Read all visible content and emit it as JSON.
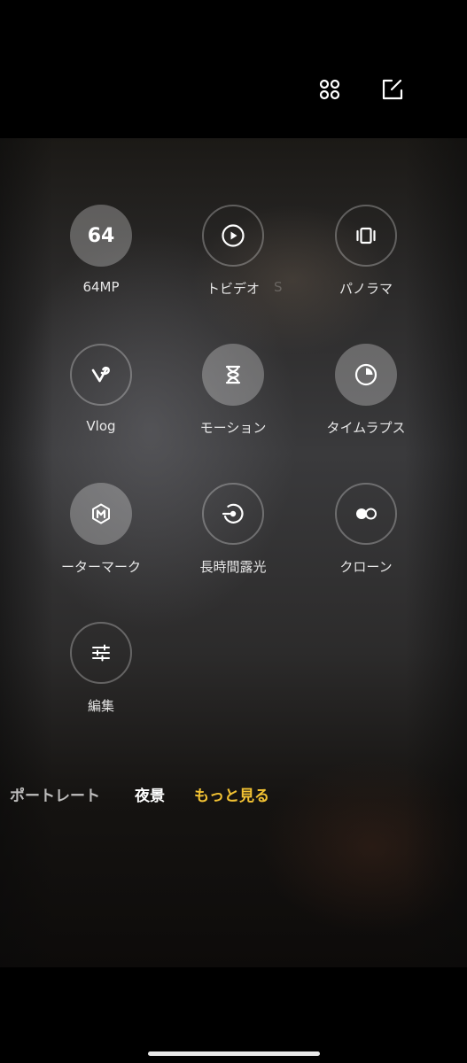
{
  "top_controls": {
    "grid_icon": "four-circles-grid-icon",
    "edit_icon": "edit-square-pencil-icon"
  },
  "modes": [
    {
      "id": "64mp",
      "label": "64MP",
      "icon_text": "64",
      "filled": true
    },
    {
      "id": "short-video",
      "label": "トビデオ",
      "icon": "play-circle-icon",
      "filled": false,
      "ghost_label": "S"
    },
    {
      "id": "panorama",
      "label": "パノラマ",
      "icon": "panorama-icon",
      "filled": false
    },
    {
      "id": "vlog",
      "label": "Vlog",
      "icon": "vlog-v-icon",
      "filled": false
    },
    {
      "id": "slow-motion",
      "label": "モーション",
      "icon": "hourglass-icon",
      "filled": true
    },
    {
      "id": "timelapse",
      "label": "タイムラプス",
      "icon": "pie-clock-icon",
      "filled": true
    },
    {
      "id": "watermark",
      "label": "ーターマーク",
      "icon": "hexagon-m-icon",
      "filled": true
    },
    {
      "id": "long-exposure",
      "label": "長時間露光",
      "icon": "long-exposure-icon",
      "filled": false
    },
    {
      "id": "clone",
      "label": "クローン",
      "icon": "clone-dots-icon",
      "filled": false
    },
    {
      "id": "edit",
      "label": "編集",
      "icon": "sliders-icon",
      "filled": false
    }
  ],
  "mode_strip": {
    "items": [
      "ポートレート",
      "夜景",
      "もっと見る"
    ],
    "active_index": 2
  },
  "colors": {
    "active_mode": "#f2c233",
    "background": "#000000"
  }
}
